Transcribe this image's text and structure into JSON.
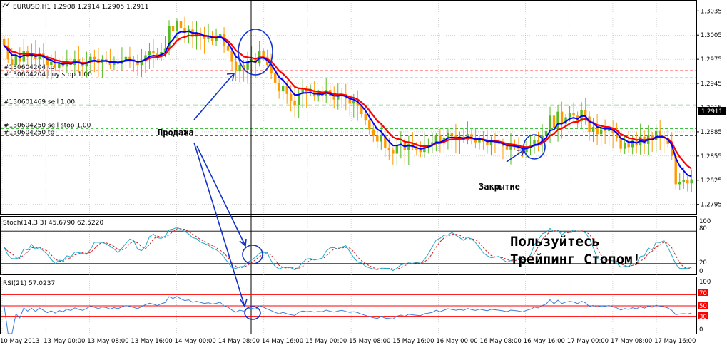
{
  "window": {
    "title_line": "EURUSD,H1  1.2908 1.2914 1.2905 1.2911"
  },
  "colors": {
    "bull": "#55bb22",
    "bear": "#ff9900",
    "fast_ma": "#0000ff",
    "slow_ma": "#ff0000",
    "stoch_main": "#22a8c8",
    "stoch_signal": "#cc2222",
    "rsi_line": "#3a7fd8",
    "price_label_bg": "#000000",
    "grid": "#aaaaaa",
    "level_red": "#ff0000",
    "level_green": "#00aa00",
    "markup": "#1133cc"
  },
  "orders": [
    {
      "label": "#130604204 tp",
      "price": 1.2961,
      "style": "red-dash"
    },
    {
      "label": "#130604204 buy stop 1.00",
      "price": 1.2952,
      "style": "green-dash-light"
    },
    {
      "label": "#130601469 sell 1.00",
      "price": 1.2918,
      "style": "green-dash"
    },
    {
      "label": "#130604250 sell stop 1.00",
      "price": 1.2889,
      "style": "green-dash-light"
    },
    {
      "label": "#130604250 tp",
      "price": 1.288,
      "style": "red-dash"
    }
  ],
  "current_price": "1.2911",
  "annotations": {
    "sell": "Продажа",
    "close": "Закрытие",
    "slogan_line1": "Пользуйтесь",
    "slogan_line2": "Трейпинг Стопом!"
  },
  "stoch_panel": {
    "label": "Stoch(14,3,3) 45.6790 62.5220",
    "levels": [
      "100",
      "80",
      "20",
      "0"
    ]
  },
  "rsi_panel": {
    "label": "RSI(21) 57.0237",
    "levels": [
      "70",
      "50",
      "30"
    ],
    "axis_max": "100",
    "axis_min": "0"
  },
  "chart_data": {
    "type": "candlestick",
    "symbol": "EURUSD",
    "timeframe": "H1",
    "y_ticks": [
      "1.3035",
      "1.3005",
      "1.2975",
      "1.2945",
      "1.2915",
      "1.2885",
      "1.2855",
      "1.2825",
      "1.2795"
    ],
    "ylim": [
      1.2785,
      1.3045
    ],
    "x_ticks": [
      "10 May 2013",
      "13 May 00:00",
      "13 May 08:00",
      "13 May 16:00",
      "14 May 00:00",
      "14 May 08:00",
      "14 May 16:00",
      "15 May 00:00",
      "15 May 08:00",
      "15 May 16:00",
      "16 May 00:00",
      "16 May 08:00",
      "16 May 16:00",
      "17 May 00:00",
      "17 May 08:00",
      "17 May 16:00"
    ],
    "close": [
      1.2992,
      1.2975,
      1.2968,
      1.298,
      1.2972,
      1.2985,
      1.2978,
      1.2983,
      1.2975,
      1.2982,
      1.2976,
      1.2968,
      1.2972,
      1.2964,
      1.297,
      1.2966,
      1.2972,
      1.2968,
      1.2975,
      1.297,
      1.2966,
      1.2972,
      1.2978,
      1.2975,
      1.297,
      1.2975,
      1.2973,
      1.2968,
      1.2972,
      1.2969,
      1.2974,
      1.2978,
      1.2975,
      1.2972,
      1.2968,
      1.2974,
      1.298,
      1.2985,
      1.2982,
      1.2978,
      1.2984,
      1.2988,
      1.3016,
      1.301,
      1.3022,
      1.3014,
      1.3008,
      1.3012,
      1.3003,
      1.3008,
      1.3004,
      1.3,
      1.3003,
      1.2998,
      1.3001,
      1.3006,
      1.2992,
      1.2986,
      1.2972,
      1.296,
      1.2968,
      1.2962,
      1.2973,
      1.2975,
      1.297,
      1.2985,
      1.2978,
      1.2968,
      1.2958,
      1.2946,
      1.2936,
      1.2942,
      1.2932,
      1.2924,
      1.2918,
      1.2932,
      1.2938,
      1.2933,
      1.2935,
      1.2929,
      1.2932,
      1.293,
      1.2937,
      1.293,
      1.2925,
      1.2929,
      1.2932,
      1.2926,
      1.292,
      1.2923,
      1.2917,
      1.2907,
      1.2899,
      1.2888,
      1.288,
      1.2873,
      1.288,
      1.2865,
      1.2862,
      1.2858,
      1.2868,
      1.2872,
      1.2862,
      1.287,
      1.2866,
      1.2862,
      1.286,
      1.2867,
      1.2869,
      1.2872,
      1.288,
      1.2872,
      1.2878,
      1.2884,
      1.288,
      1.2876,
      1.2879,
      1.2875,
      1.2882,
      1.2876,
      1.2872,
      1.2877,
      1.2873,
      1.2869,
      1.2874,
      1.2872,
      1.287,
      1.2867,
      1.2863,
      1.2868,
      1.2866,
      1.2864,
      1.286,
      1.2865,
      1.2868,
      1.2875,
      1.2872,
      1.288,
      1.2886,
      1.2905,
      1.289,
      1.291,
      1.2895,
      1.2903,
      1.2908,
      1.2905,
      1.2898,
      1.2912,
      1.2904,
      1.2885,
      1.2891,
      1.2882,
      1.2888,
      1.2886,
      1.289,
      1.2883,
      1.2877,
      1.2864,
      1.2871,
      1.2866,
      1.2874,
      1.2868,
      1.2879,
      1.287,
      1.2881,
      1.2875,
      1.2886,
      1.288,
      1.2877,
      1.287,
      1.2855,
      1.282,
      1.2823,
      1.2825,
      1.2821,
      1.2826
    ]
  }
}
